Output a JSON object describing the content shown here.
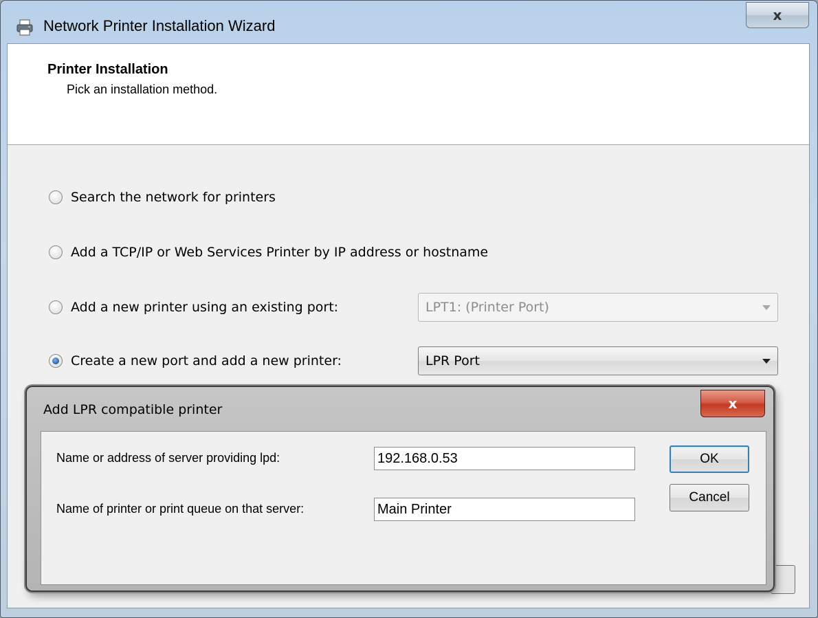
{
  "window": {
    "title": "Network Printer Installation Wizard",
    "close_glyph": "x",
    "icon": "printer-icon"
  },
  "header": {
    "title": "Printer Installation",
    "subtitle": "Pick an installation method."
  },
  "options": [
    {
      "label": "Search the network for printers",
      "checked": false
    },
    {
      "label": "Add a TCP/IP or Web Services Printer by IP address or hostname",
      "checked": false
    },
    {
      "label": "Add a new printer using an existing port:",
      "checked": false
    },
    {
      "label": "Create a new port and add a new printer:",
      "checked": true
    }
  ],
  "existing_port_combo": {
    "value": "LPT1: (Printer Port)",
    "enabled": false
  },
  "new_port_combo": {
    "value": "LPR Port",
    "enabled": true
  },
  "lpr_dialog": {
    "title": "Add LPR compatible printer",
    "close_glyph": "x",
    "server_label": "Name or address of server providing lpd:",
    "server_value": "192.168.0.53",
    "queue_label": "Name of printer or print queue on that server:",
    "queue_value": "Main Printer",
    "ok_label": "OK",
    "cancel_label": "Cancel"
  },
  "colors": {
    "titlebar": "#b9d1ea",
    "close_red": "#c23a20",
    "radio_selected": "#2a5fa8",
    "default_button_border": "#3c7fb1"
  }
}
